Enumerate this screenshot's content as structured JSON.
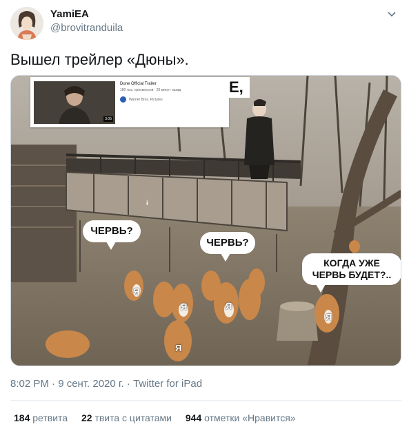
{
  "author": {
    "name": "YamiEA",
    "handle": "@brovitranduila"
  },
  "tweet": {
    "text": "Вышел трейлер «Дюны»."
  },
  "media": {
    "video_card": {
      "title": "Dune Official Trailer",
      "meta": "180 тыс. просмотров · 20 минут назад",
      "channel": "Warner Bros. Pictures",
      "duration": "3:05",
      "overflow_text": "Е,"
    },
    "bubbles": [
      "ЧЕРВЬ?",
      "ЧЕРВЬ?",
      "КОГДА УЖЕ",
      "ЧЕРВЬ БУДЕТ?.."
    ],
    "fox_label": "Я",
    "person_label": "i"
  },
  "timestamp": "8:02 PM · 9 сент. 2020 г. · Twitter for iPad",
  "stats": {
    "retweets_count": "184",
    "retweets_label": "ретвита",
    "quotes_count": "22",
    "quotes_label": "твита с цитатами",
    "likes_count": "944",
    "likes_label": "отметки «Нравится»"
  },
  "colors": {
    "text_primary": "#14171a",
    "text_secondary": "#657786",
    "divider": "#e6ecf0"
  },
  "icons": [
    "avatar",
    "chevron-down-icon",
    "warner-bros-icon"
  ]
}
